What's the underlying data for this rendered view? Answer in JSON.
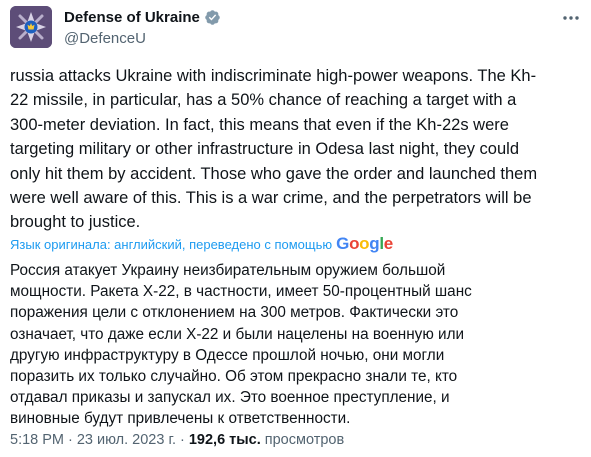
{
  "author": {
    "display_name": "Defense of Ukraine",
    "handle": "@DefenceU",
    "avatar_icon": "ministry-of-defense-emblem",
    "verified_icon": "verified-badge-icon",
    "verified_color": "#829aab"
  },
  "tweet": {
    "text_en_lines": [
      "russia attacks Ukraine with indiscriminate high-power weapons. The Kh-",
      "22 missile, in particular, has a 50% chance of reaching a target with a",
      "300-meter deviation. In fact, this means that even if the Kh-22s were",
      "targeting military or other infrastructure in Odesa last night, they could",
      "only hit them by accident. Those who gave the order and launched them",
      "were well aware of this. This is a war crime, and the perpetrators will be",
      "brought to justice."
    ],
    "translation_note": "Язык оригинала: английский, переведено с помощью",
    "translation_provider": "Google",
    "text_ru_lines": [
      "Россия атакует Украину неизбирательным оружием большой",
      "мощности. Ракета Х-22, в частности, имеет 50-процентный шанс",
      "поражения цели с отклонением на 300 метров. Фактически это",
      "означает, что даже если Х-22 и были нацелены на военную или",
      "другую инфраструктуру в Одессе прошлой ночью, они могли",
      "поразить их только случайно. Об этом прекрасно знали те, кто",
      "отдавал приказы и запускал их. Это военное преступление, и",
      "виновные будут привлечены к ответственности."
    ]
  },
  "meta": {
    "time": "5:18 PM",
    "separator": "·",
    "date": "23 июл. 2023 г.",
    "views_count": "192,6 тыс.",
    "views_label": "просмотров"
  },
  "colors": {
    "text": "#0f1419",
    "secondary": "#536471",
    "link": "#1d9bf0"
  }
}
